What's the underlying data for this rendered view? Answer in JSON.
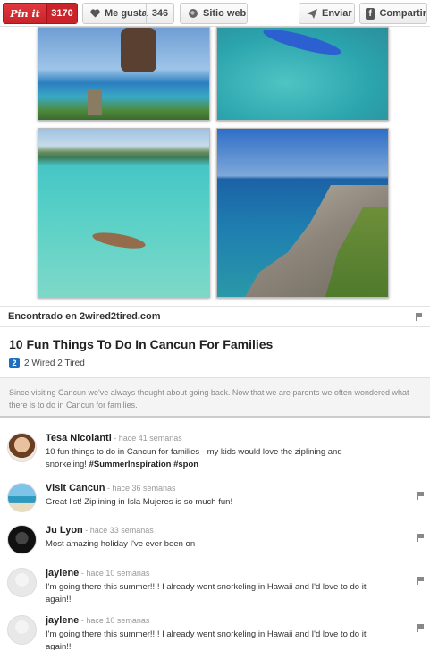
{
  "toolbar": {
    "pinit_label": "Pin it",
    "pinit_count": "3170",
    "like_label": "Me gusta",
    "like_count": "346",
    "web_label": "Sitio web",
    "send_label": "Enviar",
    "share_label": "Compartir"
  },
  "source": {
    "text": "Encontrado en 2wired2tired.com"
  },
  "pin": {
    "title": "10 Fun Things To Do In Cancun For Families",
    "board_badge": "2",
    "board_name": "2 Wired 2 Tired",
    "description": "Since visiting Cancun we've always thought about going back. Now that we are parents we often wondered what there is to do in Cancun for families."
  },
  "comments": [
    {
      "name": "Tesa Nicolanti",
      "time": "hace 41 semanas",
      "text": "10 fun things to do in Cancun for families - my kids would love the ziplining and snorkeling! ",
      "tags": "#SummerInspiration #spon"
    },
    {
      "name": "Visit Cancun",
      "time": "hace 36 semanas",
      "text": "Great list! Ziplining in Isla Mujeres is so much fun!"
    },
    {
      "name": "Ju Lyon",
      "time": "hace 33 semanas",
      "text": "Most amazing holiday I've ever been on"
    },
    {
      "name": "jaylene",
      "time": "hace 10 semanas",
      "text": "I'm going there this summer!!!! I already went snorkeling in Hawaii and I'd love to do it again!!"
    },
    {
      "name": "jaylene",
      "time": "hace 10 semanas",
      "text": "I'm going there this summer!!!! I already went snorkeling in Hawaii and I'd love to do it again!!"
    }
  ],
  "separator": " - "
}
